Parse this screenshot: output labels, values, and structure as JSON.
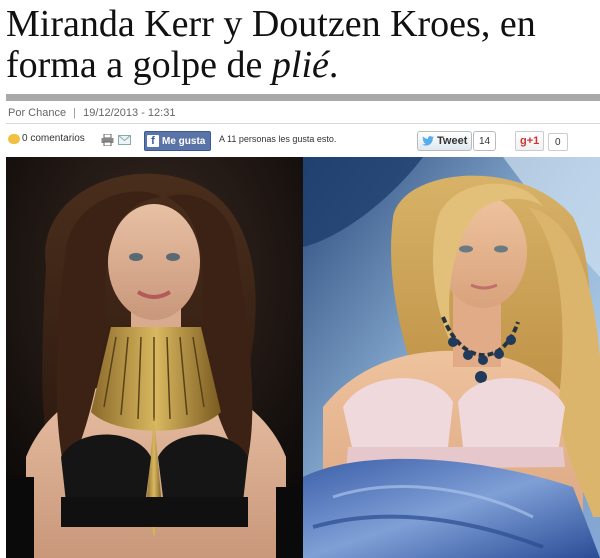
{
  "article": {
    "title_main": "Miranda Kerr y Doutzen Kroes, en forma a golpe de ",
    "title_italic": "plié",
    "title_end": "."
  },
  "meta": {
    "author": "Por Chance",
    "separator": "|",
    "date": "19/12/2013 - 12:31"
  },
  "share": {
    "comments": "0 comentarios",
    "fb_like": "Me gusta",
    "fb_count": "A 11 personas les gusta esto.",
    "tweet_label": "Tweet",
    "tweet_count": "14",
    "gplus_label": "g+1",
    "gplus_count": "0"
  },
  "colors": {
    "facebook": "#3b5998",
    "twitter": "#55acee",
    "gplus": "#dd4b39",
    "bar": "#a9a9a9"
  },
  "icons": [
    "comment-bubble-icon",
    "print-icon",
    "mail-icon",
    "facebook-icon",
    "twitter-bird-icon"
  ]
}
